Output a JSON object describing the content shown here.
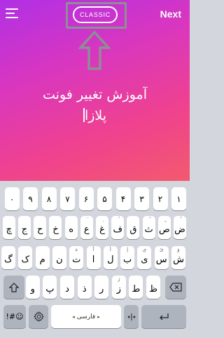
{
  "header": {
    "menu_icon": "hamburger-menu-icon",
    "style_label": "CLASSIC",
    "next_label": "Next"
  },
  "colors": {
    "gradient_start": "#b030e6",
    "gradient_end": "#f25a6e",
    "highlight_frame": "#8d8f94",
    "keyboard_bg": "#d3d6dd"
  },
  "annotation": {
    "arrow_icon": "up-arrow-icon"
  },
  "editor": {
    "line1": "آموزش تغییر فونت",
    "line2": "پلازا"
  },
  "keyboard": {
    "digits": [
      "۱",
      "۲",
      "۳",
      "۴",
      "۵",
      "۶",
      "۷",
      "۸",
      "۹",
      "۰"
    ],
    "row1": [
      {
        "main": "ض",
        "sub": "ٌ"
      },
      {
        "main": "ص",
        "sub": "ٍ"
      },
      {
        "main": "ث",
        "sub": "ً"
      },
      {
        "main": "ق",
        "sub": ""
      },
      {
        "main": "ف",
        "sub": "ُ"
      },
      {
        "main": "غ",
        "sub": "ِ"
      },
      {
        "main": "ع",
        "sub": "َ"
      },
      {
        "main": "ه",
        "sub": ""
      },
      {
        "main": "خ",
        "sub": ""
      },
      {
        "main": "ح",
        "sub": ""
      },
      {
        "main": "ج",
        "sub": ""
      },
      {
        "main": "چ",
        "sub": ""
      }
    ],
    "row2": [
      {
        "main": "ش",
        "sub": "ؤ"
      },
      {
        "main": "س",
        "sub": "ئ"
      },
      {
        "main": "ی",
        "sub": "ي"
      },
      {
        "main": "ب",
        "sub": "إ"
      },
      {
        "main": "ل",
        "sub": "أ"
      },
      {
        "main": "ا",
        "sub": "آ"
      },
      {
        "main": "ت",
        "sub": "ة"
      },
      {
        "main": "ن",
        "sub": ""
      },
      {
        "main": "م",
        "sub": ""
      },
      {
        "main": "ک",
        "sub": ""
      },
      {
        "main": "گ",
        "sub": ""
      }
    ],
    "row3": [
      {
        "main": "ظ",
        "sub": ""
      },
      {
        "main": "ط",
        "sub": ""
      },
      {
        "main": "ز",
        "sub": "ژ"
      },
      {
        "main": "ر",
        "sub": ""
      },
      {
        "main": "ذ",
        "sub": ""
      },
      {
        "main": "د",
        "sub": ""
      },
      {
        "main": "پ",
        "sub": ""
      },
      {
        "main": "و",
        "sub": ""
      }
    ],
    "shift_icon": "shift-arrow-icon",
    "backspace_icon": "backspace-icon",
    "symbols_label": "!#☺",
    "settings_icon": "gear-icon",
    "space_label": "فارسی",
    "cursor_icon": "cursor-move-icon",
    "enter_icon": "return-icon"
  }
}
